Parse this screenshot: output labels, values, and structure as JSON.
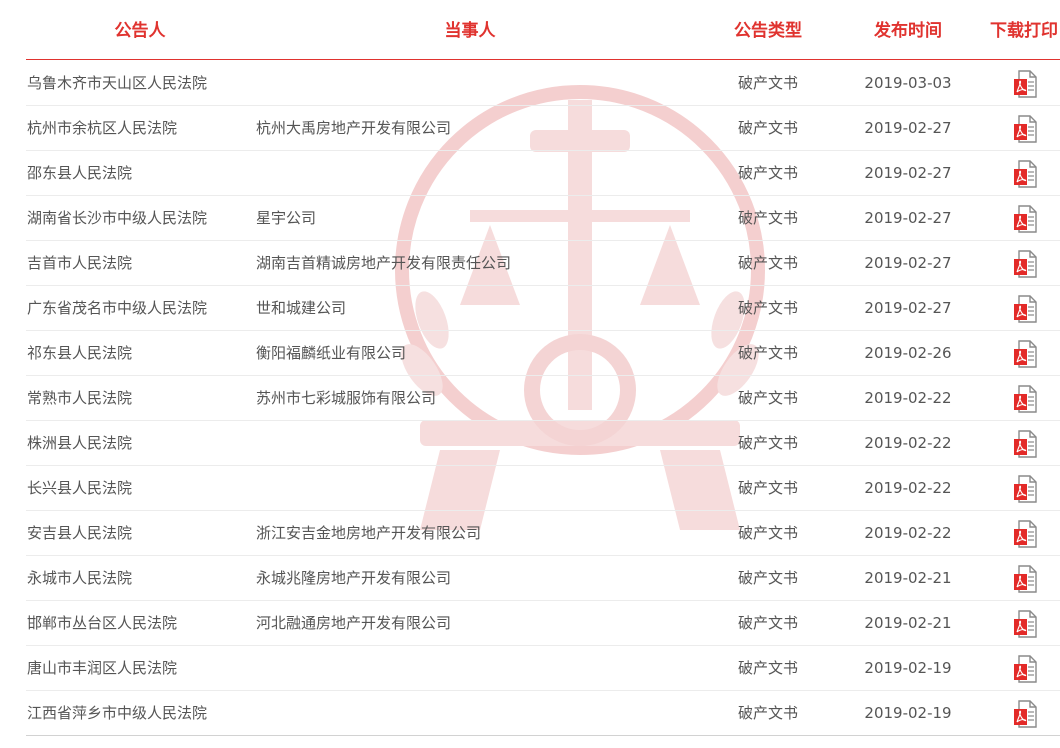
{
  "headers": {
    "announcer": "公告人",
    "party": "当事人",
    "type": "公告类型",
    "date": "发布时间",
    "download": "下载打印"
  },
  "colors": {
    "accent": "#e0332f",
    "text": "#555555",
    "divider": "#ececec"
  },
  "icons": {
    "download": "pdf-file-icon",
    "background": "court-emblem-watermark"
  },
  "rows": [
    {
      "announcer": "乌鲁木齐市天山区人民法院",
      "party": "",
      "type": "破产文书",
      "date": "2019-03-03"
    },
    {
      "announcer": "杭州市余杭区人民法院",
      "party": "杭州大禹房地产开发有限公司",
      "type": "破产文书",
      "date": "2019-02-27"
    },
    {
      "announcer": "邵东县人民法院",
      "party": "",
      "type": "破产文书",
      "date": "2019-02-27"
    },
    {
      "announcer": "湖南省长沙市中级人民法院",
      "party": "星宇公司",
      "type": "破产文书",
      "date": "2019-02-27"
    },
    {
      "announcer": "吉首市人民法院",
      "party": "湖南吉首精诚房地产开发有限责任公司",
      "type": "破产文书",
      "date": "2019-02-27"
    },
    {
      "announcer": "广东省茂名市中级人民法院",
      "party": "世和城建公司",
      "type": "破产文书",
      "date": "2019-02-27"
    },
    {
      "announcer": "祁东县人民法院",
      "party": "衡阳福麟纸业有限公司",
      "type": "破产文书",
      "date": "2019-02-26"
    },
    {
      "announcer": "常熟市人民法院",
      "party": "苏州市七彩城服饰有限公司",
      "type": "破产文书",
      "date": "2019-02-22"
    },
    {
      "announcer": "株洲县人民法院",
      "party": "",
      "type": "破产文书",
      "date": "2019-02-22"
    },
    {
      "announcer": "长兴县人民法院",
      "party": "",
      "type": "破产文书",
      "date": "2019-02-22"
    },
    {
      "announcer": "安吉县人民法院",
      "party": "浙江安吉金地房地产开发有限公司",
      "type": "破产文书",
      "date": "2019-02-22"
    },
    {
      "announcer": "永城市人民法院",
      "party": "永城兆隆房地产开发有限公司",
      "type": "破产文书",
      "date": "2019-02-21"
    },
    {
      "announcer": "邯郸市丛台区人民法院",
      "party": "河北融通房地产开发有限公司",
      "type": "破产文书",
      "date": "2019-02-21"
    },
    {
      "announcer": "唐山市丰润区人民法院",
      "party": "",
      "type": "破产文书",
      "date": "2019-02-19"
    },
    {
      "announcer": "江西省萍乡市中级人民法院",
      "party": "",
      "type": "破产文书",
      "date": "2019-02-19"
    }
  ]
}
